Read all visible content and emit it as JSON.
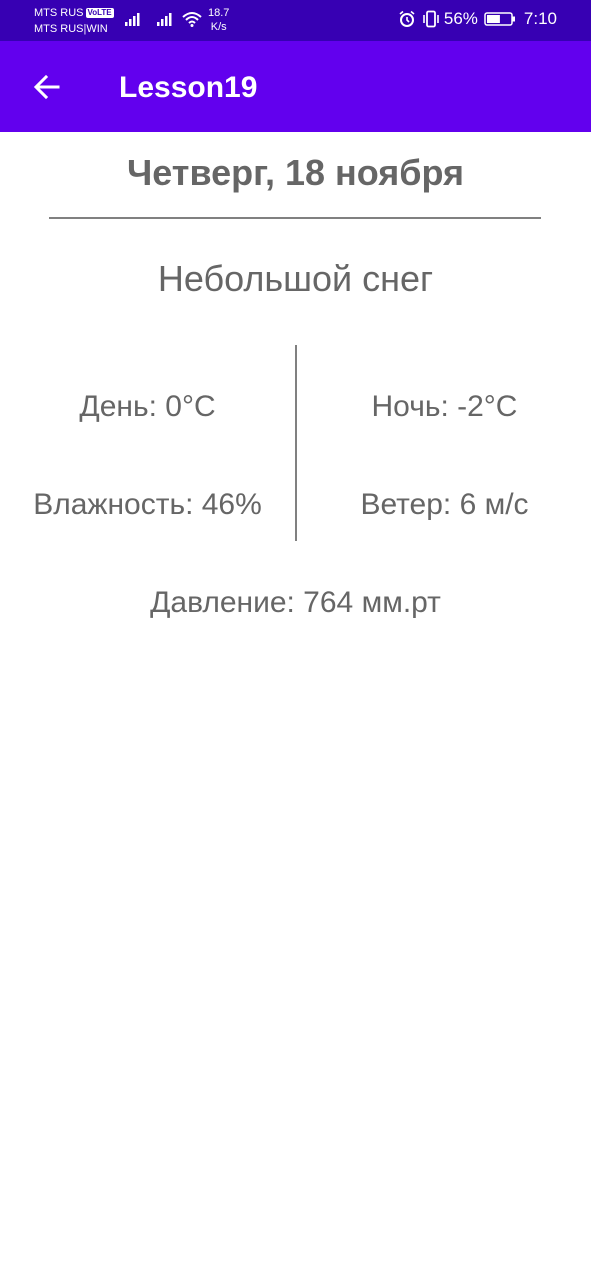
{
  "status_bar": {
    "carrier_1": "MTS RUS",
    "volte": "VoLTE",
    "carrier_2": "MTS RUS|WIN",
    "speed_value": "18.7",
    "speed_unit": "K/s",
    "battery_percent": "56%",
    "time": "7:10",
    "icons": [
      "signal-icon",
      "signal-icon",
      "wifi-icon",
      "alarm-icon",
      "vibrate-icon",
      "battery-icon"
    ],
    "battery_level": 0.56
  },
  "app_bar": {
    "title": "Lesson19",
    "back_icon": "arrow-back-icon",
    "color": "#6200ee"
  },
  "weather": {
    "date": "Четверг, 18 ноября",
    "description": "Небольшой снег",
    "day_temp": "День: 0°C",
    "night_temp": "Ночь: -2°C",
    "humidity": "Влажность: 46%",
    "wind": "Ветер: 6 м/с",
    "pressure": "Давление: 764 мм.рт"
  },
  "colors": {
    "status_bar": "#3700b3",
    "app_bar": "#6200ee",
    "text": "#666666"
  }
}
